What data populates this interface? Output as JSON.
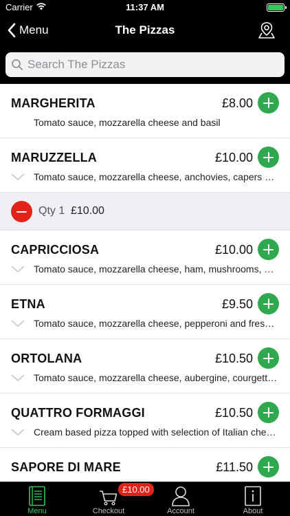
{
  "status": {
    "carrier": "Carrier",
    "time": "11:37 AM",
    "battery_level": 1.0
  },
  "nav": {
    "back_label": "Menu",
    "title": "The Pizzas",
    "map_icon": "map-pin-icon"
  },
  "search": {
    "placeholder": "Search The Pizzas",
    "value": ""
  },
  "items": [
    {
      "name": "MARGHERITA",
      "price": "£8.00",
      "description": "Tomato sauce, mozzarella cheese and basil"
    },
    {
      "name": "MARUZZELLA",
      "price": "£10.00",
      "description": "Tomato sauce, mozzarella cheese, anchovies, capers and olives"
    },
    {
      "name": "CAPRICCIOSA",
      "price": "£10.00",
      "description": "Tomato sauce, mozzarella cheese, ham, mushrooms, olives and artichokes"
    },
    {
      "name": "ETNA",
      "price": "£9.50",
      "description": "Tomato sauce, mozzarella cheese, pepperoni and fresh chilli"
    },
    {
      "name": "ORTOLANA",
      "price": "£10.50",
      "description": "Tomato sauce, mozzarella cheese, aubergine, courgettes and peppers"
    },
    {
      "name": "QUATTRO FORMAGGI",
      "price": "£10.50",
      "description": "Cream based pizza topped with selection of Italian cheeses"
    },
    {
      "name": "SAPORE DI MARE",
      "price": "£11.50",
      "description": ""
    }
  ],
  "cart_line": {
    "qty_label": "Qty 1",
    "price": "£10.00"
  },
  "tabs": [
    {
      "label": "Menu",
      "icon": "menu-book-icon"
    },
    {
      "label": "Checkout",
      "icon": "cart-icon",
      "badge": "£10.00"
    },
    {
      "label": "Account",
      "icon": "user-icon"
    },
    {
      "label": "About",
      "icon": "info-icon"
    }
  ],
  "colors": {
    "accent_green": "#2fa84f",
    "remove_red": "#e2231a",
    "bar_black": "#000000"
  }
}
